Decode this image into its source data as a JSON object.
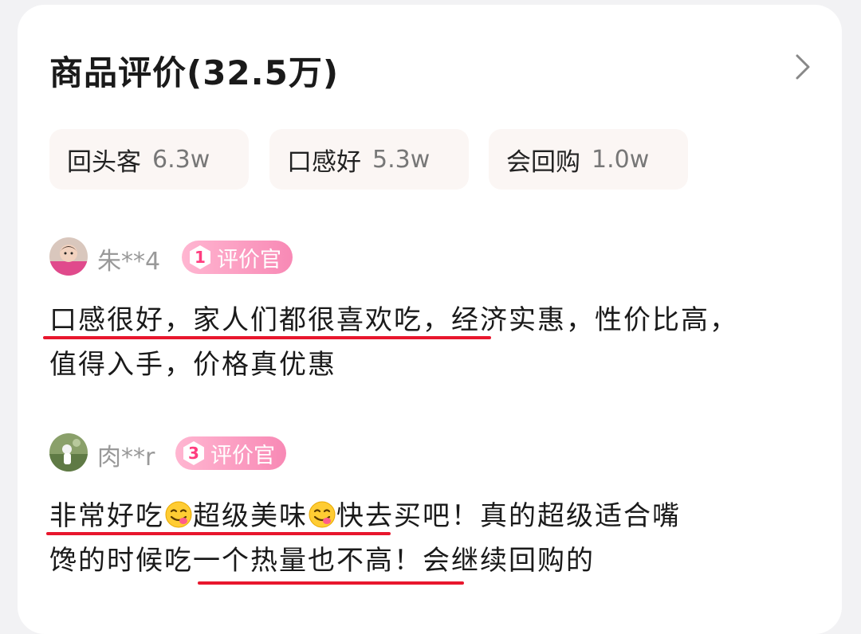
{
  "header": {
    "title": "商品评价(32.5万)"
  },
  "tags": [
    {
      "name": "回头客",
      "count": "6.3w"
    },
    {
      "name": "口感好",
      "count": "5.3w"
    },
    {
      "name": "会回购",
      "count": "1.0w"
    }
  ],
  "reviews": [
    {
      "user": "朱**4",
      "level": "1",
      "badge": "评价官",
      "line1": "口感很好，家人们都很喜欢吃，经济实惠，性价比高，",
      "line2": "值得入手，价格真优惠"
    },
    {
      "user": "肉**r",
      "level": "3",
      "badge": "评价官",
      "seg1": "非常好吃",
      "seg2": "超级美味",
      "seg3": "快去买吧！真的超级适合嘴",
      "line2": "馋的时候吃一个热量也不高！会继续回购的",
      "emoji": "yum-face-icon"
    }
  ],
  "colors": {
    "underline": "#e8162d",
    "badge": "#f889b5",
    "tag_bg": "#fbf6f4"
  }
}
